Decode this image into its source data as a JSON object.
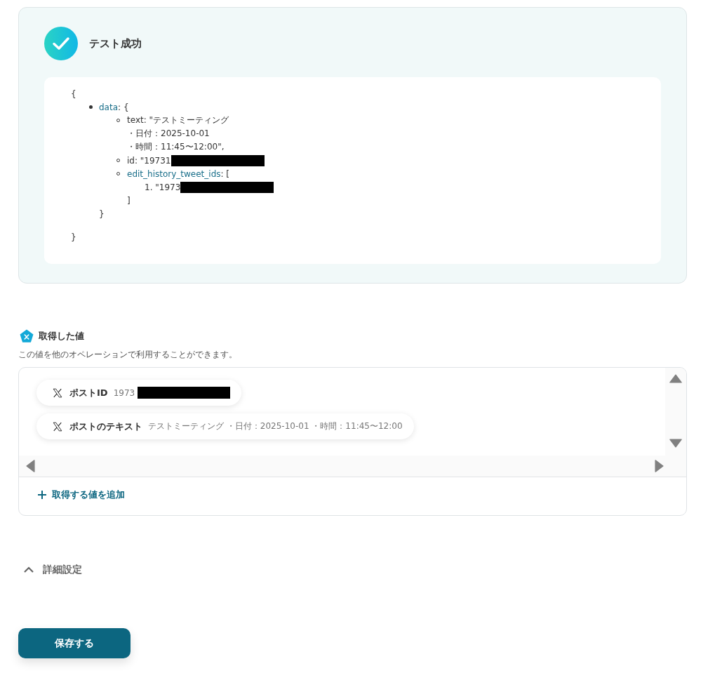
{
  "test_result": {
    "kind": "success",
    "title": "テスト成功",
    "preview": {
      "open": "{",
      "close": "}",
      "entries": [
        {
          "key": "data",
          "kind": "object",
          "after": ": {",
          "end": "}",
          "children": [
            {
              "key": "text",
              "kind": "plain",
              "after": ": \"テストミーティング",
              "lines": [
                "・日付：2025-10-01",
                "・時間：11:45〜12:00\","
              ]
            },
            {
              "key": "id",
              "kind": "plain",
              "after": ": \"19731",
              "redacted": true
            },
            {
              "key": "edit_history_tweet_ids",
              "kind": "array",
              "after": ": [",
              "end": "]",
              "items": [
                {
                  "number": "1.",
                  "value": "\"1973",
                  "redacted": true
                }
              ]
            }
          ]
        }
      ]
    }
  },
  "captured_values": {
    "title": "取得した値",
    "description": "この値を他のオペレーションで利用することができます。",
    "chips": [
      {
        "label": "ポストID",
        "value": "1973",
        "redacted": true
      },
      {
        "label": "ポストのテキスト",
        "value": "テストミーティング ・日付：2025-10-01 ・時間：11:45〜12:00",
        "redacted": false
      }
    ],
    "add_label": "取得する値を追加"
  },
  "advanced": {
    "label": "詳細設定",
    "expanded": true
  },
  "save_button": "保存する"
}
